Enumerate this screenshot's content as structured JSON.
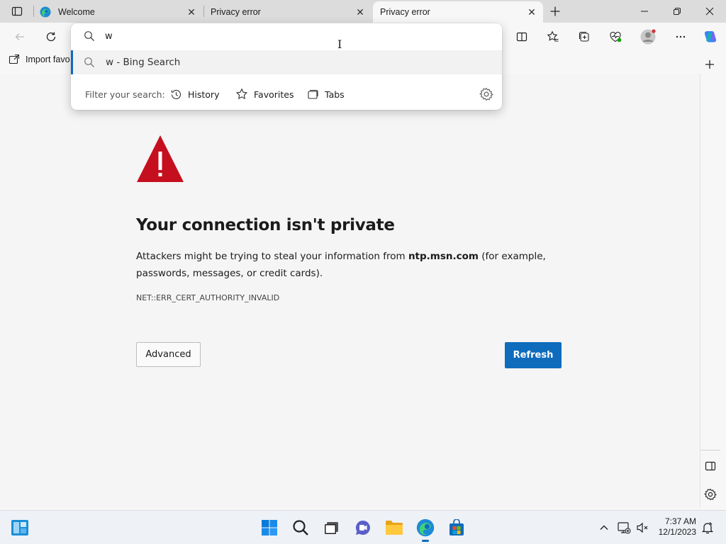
{
  "tabs": [
    {
      "title": "Welcome",
      "icon": "edge-logo-icon"
    },
    {
      "title": "Privacy error",
      "icon": "none"
    },
    {
      "title": "Privacy error",
      "icon": "none",
      "active": true
    }
  ],
  "favorites_bar": {
    "import_label": "Import favo"
  },
  "omnibox": {
    "value": "w",
    "suggestion": "w - Bing Search",
    "filter_label": "Filter your search:",
    "filters": [
      "History",
      "Favorites",
      "Tabs"
    ]
  },
  "error_page": {
    "title": "Your connection isn't private",
    "desc_prefix": "Attackers might be trying to steal your information from ",
    "desc_host": "ntp.msn.com",
    "desc_suffix": " (for example, passwords, messages, or credit cards).",
    "code": "NET::ERR_CERT_AUTHORITY_INVALID",
    "advanced_label": "Advanced",
    "refresh_label": "Refresh"
  },
  "taskbar": {
    "time": "7:37 AM",
    "date": "12/1/2023"
  },
  "colors": {
    "accent": "#0f6cbd",
    "warning_red": "#c50f1f"
  }
}
